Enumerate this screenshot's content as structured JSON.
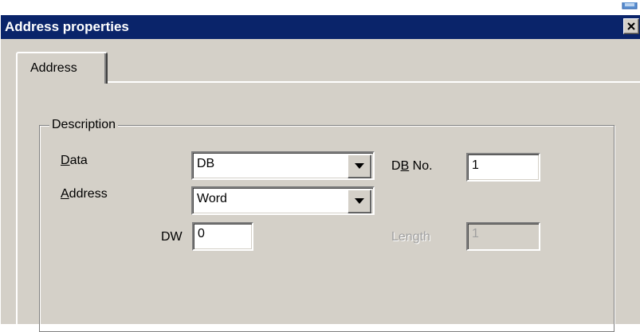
{
  "window": {
    "title": "Address properties",
    "close_glyph": "×"
  },
  "tabs": [
    {
      "label": "Address",
      "active": true
    }
  ],
  "group": {
    "title": "Description"
  },
  "fields": {
    "data": {
      "label_mnemonic": "D",
      "label_rest": "ata",
      "value": "DB"
    },
    "address": {
      "label_mnemonic": "A",
      "label_rest": "ddress",
      "value": "Word"
    },
    "db_no": {
      "label_pre": "D",
      "label_mnemonic": "B",
      "label_rest": " No.",
      "value": "1"
    },
    "dw": {
      "label": "DW",
      "value": "0"
    },
    "length": {
      "label": "Length",
      "value": "1",
      "disabled": true
    }
  },
  "colors": {
    "title_bar": "#0a246a",
    "dialog_face": "#d4d0c8",
    "disabled_text": "#a0a0a0"
  },
  "icons": {
    "close": "close-icon",
    "dropdown": "chevron-down-icon"
  }
}
